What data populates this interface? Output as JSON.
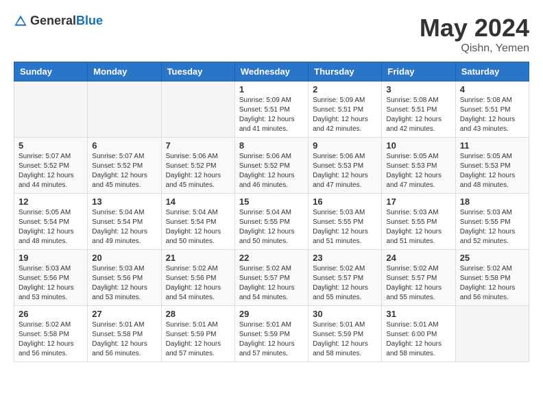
{
  "header": {
    "logo_general": "General",
    "logo_blue": "Blue",
    "month_year": "May 2024",
    "location": "Qishn, Yemen"
  },
  "days_of_week": [
    "Sunday",
    "Monday",
    "Tuesday",
    "Wednesday",
    "Thursday",
    "Friday",
    "Saturday"
  ],
  "weeks": [
    [
      {
        "day": "",
        "info": ""
      },
      {
        "day": "",
        "info": ""
      },
      {
        "day": "",
        "info": ""
      },
      {
        "day": "1",
        "info": "Sunrise: 5:09 AM\nSunset: 5:51 PM\nDaylight: 12 hours\nand 41 minutes."
      },
      {
        "day": "2",
        "info": "Sunrise: 5:09 AM\nSunset: 5:51 PM\nDaylight: 12 hours\nand 42 minutes."
      },
      {
        "day": "3",
        "info": "Sunrise: 5:08 AM\nSunset: 5:51 PM\nDaylight: 12 hours\nand 42 minutes."
      },
      {
        "day": "4",
        "info": "Sunrise: 5:08 AM\nSunset: 5:51 PM\nDaylight: 12 hours\nand 43 minutes."
      }
    ],
    [
      {
        "day": "5",
        "info": "Sunrise: 5:07 AM\nSunset: 5:52 PM\nDaylight: 12 hours\nand 44 minutes."
      },
      {
        "day": "6",
        "info": "Sunrise: 5:07 AM\nSunset: 5:52 PM\nDaylight: 12 hours\nand 45 minutes."
      },
      {
        "day": "7",
        "info": "Sunrise: 5:06 AM\nSunset: 5:52 PM\nDaylight: 12 hours\nand 45 minutes."
      },
      {
        "day": "8",
        "info": "Sunrise: 5:06 AM\nSunset: 5:52 PM\nDaylight: 12 hours\nand 46 minutes."
      },
      {
        "day": "9",
        "info": "Sunrise: 5:06 AM\nSunset: 5:53 PM\nDaylight: 12 hours\nand 47 minutes."
      },
      {
        "day": "10",
        "info": "Sunrise: 5:05 AM\nSunset: 5:53 PM\nDaylight: 12 hours\nand 47 minutes."
      },
      {
        "day": "11",
        "info": "Sunrise: 5:05 AM\nSunset: 5:53 PM\nDaylight: 12 hours\nand 48 minutes."
      }
    ],
    [
      {
        "day": "12",
        "info": "Sunrise: 5:05 AM\nSunset: 5:54 PM\nDaylight: 12 hours\nand 48 minutes."
      },
      {
        "day": "13",
        "info": "Sunrise: 5:04 AM\nSunset: 5:54 PM\nDaylight: 12 hours\nand 49 minutes."
      },
      {
        "day": "14",
        "info": "Sunrise: 5:04 AM\nSunset: 5:54 PM\nDaylight: 12 hours\nand 50 minutes."
      },
      {
        "day": "15",
        "info": "Sunrise: 5:04 AM\nSunset: 5:55 PM\nDaylight: 12 hours\nand 50 minutes."
      },
      {
        "day": "16",
        "info": "Sunrise: 5:03 AM\nSunset: 5:55 PM\nDaylight: 12 hours\nand 51 minutes."
      },
      {
        "day": "17",
        "info": "Sunrise: 5:03 AM\nSunset: 5:55 PM\nDaylight: 12 hours\nand 51 minutes."
      },
      {
        "day": "18",
        "info": "Sunrise: 5:03 AM\nSunset: 5:55 PM\nDaylight: 12 hours\nand 52 minutes."
      }
    ],
    [
      {
        "day": "19",
        "info": "Sunrise: 5:03 AM\nSunset: 5:56 PM\nDaylight: 12 hours\nand 53 minutes."
      },
      {
        "day": "20",
        "info": "Sunrise: 5:03 AM\nSunset: 5:56 PM\nDaylight: 12 hours\nand 53 minutes."
      },
      {
        "day": "21",
        "info": "Sunrise: 5:02 AM\nSunset: 5:56 PM\nDaylight: 12 hours\nand 54 minutes."
      },
      {
        "day": "22",
        "info": "Sunrise: 5:02 AM\nSunset: 5:57 PM\nDaylight: 12 hours\nand 54 minutes."
      },
      {
        "day": "23",
        "info": "Sunrise: 5:02 AM\nSunset: 5:57 PM\nDaylight: 12 hours\nand 55 minutes."
      },
      {
        "day": "24",
        "info": "Sunrise: 5:02 AM\nSunset: 5:57 PM\nDaylight: 12 hours\nand 55 minutes."
      },
      {
        "day": "25",
        "info": "Sunrise: 5:02 AM\nSunset: 5:58 PM\nDaylight: 12 hours\nand 56 minutes."
      }
    ],
    [
      {
        "day": "26",
        "info": "Sunrise: 5:02 AM\nSunset: 5:58 PM\nDaylight: 12 hours\nand 56 minutes."
      },
      {
        "day": "27",
        "info": "Sunrise: 5:01 AM\nSunset: 5:58 PM\nDaylight: 12 hours\nand 56 minutes."
      },
      {
        "day": "28",
        "info": "Sunrise: 5:01 AM\nSunset: 5:59 PM\nDaylight: 12 hours\nand 57 minutes."
      },
      {
        "day": "29",
        "info": "Sunrise: 5:01 AM\nSunset: 5:59 PM\nDaylight: 12 hours\nand 57 minutes."
      },
      {
        "day": "30",
        "info": "Sunrise: 5:01 AM\nSunset: 5:59 PM\nDaylight: 12 hours\nand 58 minutes."
      },
      {
        "day": "31",
        "info": "Sunrise: 5:01 AM\nSunset: 6:00 PM\nDaylight: 12 hours\nand 58 minutes."
      },
      {
        "day": "",
        "info": ""
      }
    ]
  ]
}
